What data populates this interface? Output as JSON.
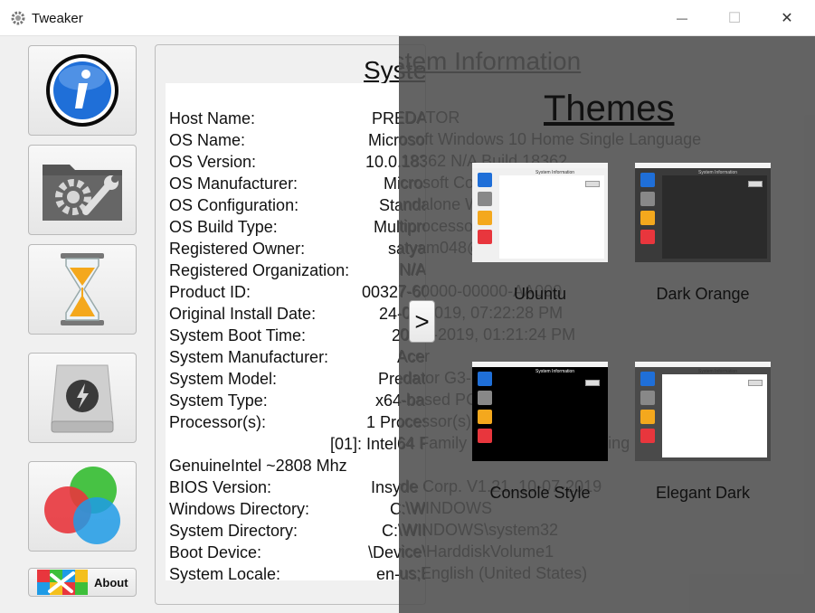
{
  "window": {
    "title": "Tweaker",
    "minimize_glyph": "—",
    "maximize_glyph": "☐",
    "close_glyph": "✕"
  },
  "sidebar": {
    "items": [
      {
        "name": "info",
        "icon": "info-icon"
      },
      {
        "name": "tools",
        "icon": "tools-folder-icon"
      },
      {
        "name": "hourglass",
        "icon": "hourglass-icon"
      },
      {
        "name": "drive",
        "icon": "drive-icon"
      },
      {
        "name": "themes",
        "icon": "color-circles-icon"
      }
    ],
    "about_label": "About"
  },
  "system_info": {
    "title": "System Information",
    "rows": [
      {
        "label": "Host Name:",
        "value": "PREDATOR"
      },
      {
        "label": "OS Name:",
        "value": "Microsoft Windows 10 Home Single Language"
      },
      {
        "label": "OS Version:",
        "value": "10.0.18362 N/A Build 18362"
      },
      {
        "label": "OS Manufacturer:",
        "value": "Microsoft Corporation"
      },
      {
        "label": "OS Configuration:",
        "value": "Standalone Workstation"
      },
      {
        "label": "OS Build Type:",
        "value": "Multiprocessor Free"
      },
      {
        "label": "Registered Owner:",
        "value": "satyam048@outlook.com"
      },
      {
        "label": "Registered Organization:",
        "value": "N/A"
      },
      {
        "label": "Product ID:",
        "value": "00327-60000-00000-AA000"
      },
      {
        "label": "Original Install Date:",
        "value": "24-05-2019, 07:22:28 PM"
      },
      {
        "label": "System Boot Time:",
        "value": "20-07-2019, 01:21:24 PM"
      },
      {
        "label": "System Manufacturer:",
        "value": "Acer"
      },
      {
        "label": "System Model:",
        "value": "Predator G3-571"
      },
      {
        "label": "System Type:",
        "value": "x64-based PC"
      },
      {
        "label": "Processor(s):",
        "value": "1 Processor(s) Installed."
      },
      {
        "label": "",
        "value": "[01]: Intel64 Family 6 Model 158 Stepping 9"
      },
      {
        "label": "GenuineIntel ~2808 Mhz",
        "value": ""
      },
      {
        "label": "BIOS Version:",
        "value": "Insyde Corp. V1.21, 10-07-2019"
      },
      {
        "label": "Windows Directory:",
        "value": "C:\\WINDOWS"
      },
      {
        "label": "System Directory:",
        "value": "C:\\WINDOWS\\system32"
      },
      {
        "label": "Boot Device:",
        "value": "\\Device\\HarddiskVolume1"
      },
      {
        "label": "System Locale:",
        "value": "en-us;English (United States)"
      }
    ]
  },
  "themes_panel": {
    "title": "Themes",
    "next_label": ">",
    "themes": [
      {
        "name": "Ubuntu",
        "preview_bg": "#ffffff",
        "preview_frame": "#f0f0f0",
        "preview_text": "#111111"
      },
      {
        "name": "Dark Orange",
        "preview_bg": "#2b2b2b",
        "preview_frame": "#3a3a3a",
        "preview_text": "#cccccc"
      },
      {
        "name": "Console Style",
        "preview_bg": "#000000",
        "preview_frame": "#000000",
        "preview_text": "#ffffff"
      },
      {
        "name": "Elegant Dark",
        "preview_bg": "#ffffff",
        "preview_frame": "#4a4a4a",
        "preview_text": "#dddddd"
      }
    ],
    "thumb_title": "System Information"
  },
  "colors": {
    "overlay": "#4e4e4e",
    "panel_bg": "#f0f0f0",
    "info_blue": "#1f6fd8"
  }
}
